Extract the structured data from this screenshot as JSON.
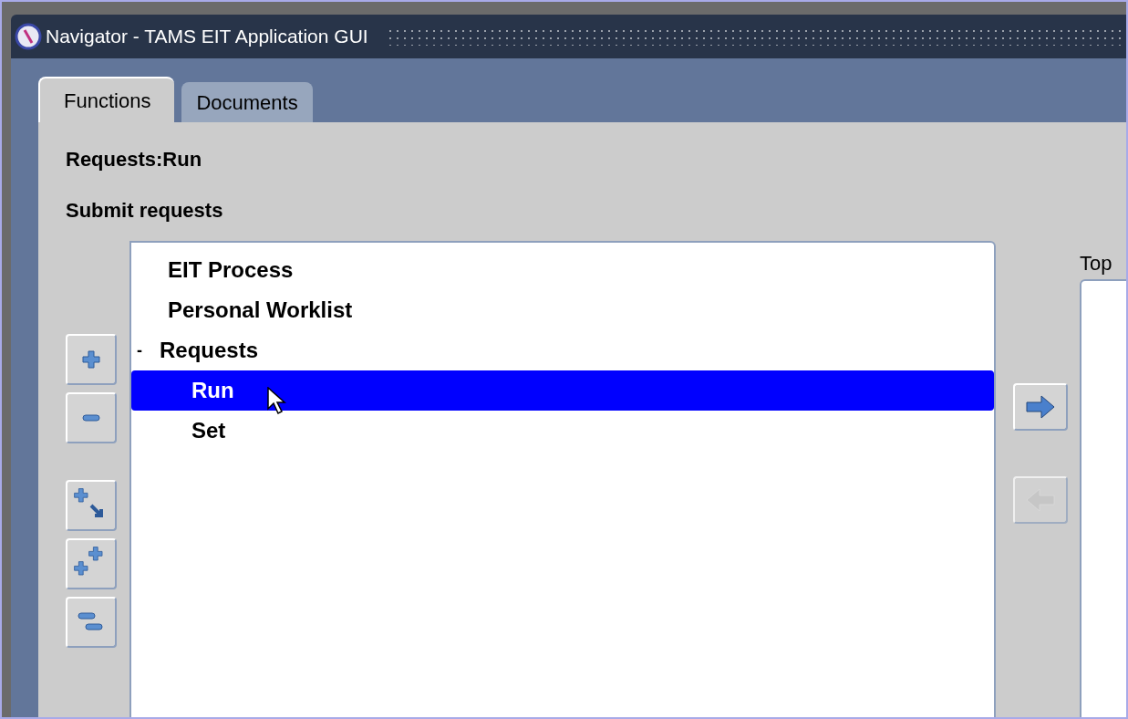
{
  "window": {
    "title": "Navigator - TAMS EIT Application GUI"
  },
  "tabs": [
    {
      "label": "Functions",
      "selected": true
    },
    {
      "label": "Documents",
      "selected": false
    }
  ],
  "function_name": "Requests:Run",
  "function_description": "Submit requests",
  "tree": [
    {
      "label": "EIT Process",
      "selected": false
    },
    {
      "label": "Personal Worklist",
      "selected": false
    },
    {
      "label": "Requests",
      "selected": false,
      "expanded": true,
      "marker": "-",
      "children": [
        {
          "label": "Run",
          "selected": true
        },
        {
          "label": "Set",
          "selected": false
        }
      ]
    }
  ],
  "tree_buttons": [
    {
      "kind": "expand"
    },
    {
      "kind": "collapse"
    },
    {
      "kind": "expand-branch"
    },
    {
      "kind": "expand-all"
    },
    {
      "kind": "collapse-all"
    }
  ],
  "move_buttons": [
    {
      "kind": "add",
      "disabled": false
    },
    {
      "kind": "remove",
      "disabled": true
    }
  ],
  "top_ten_label": "Top"
}
